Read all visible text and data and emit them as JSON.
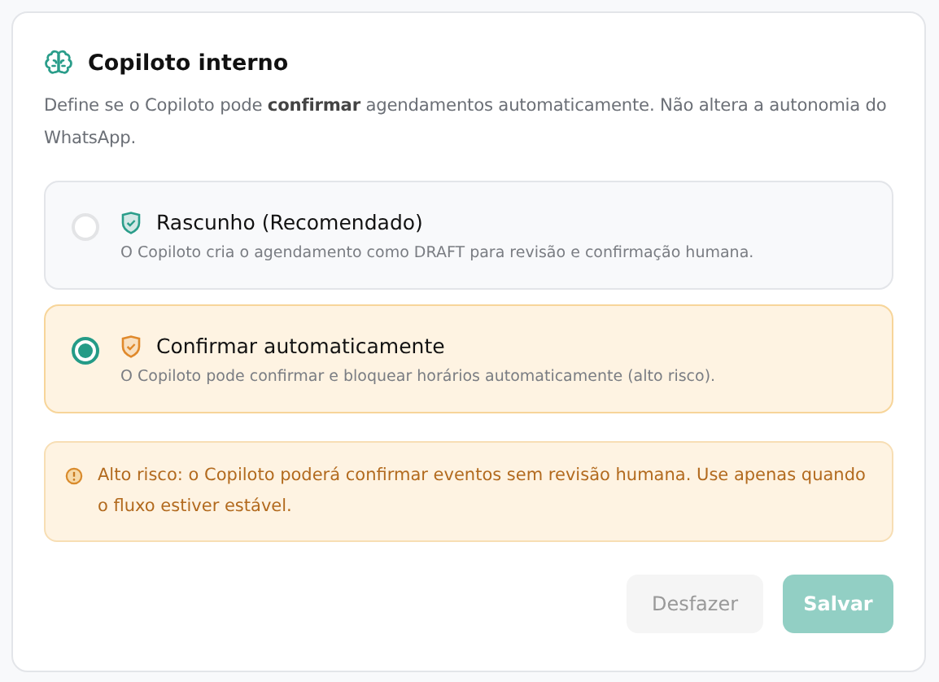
{
  "section": {
    "title": "Copiloto interno",
    "description": "Define se o Copiloto pode **confirmar** agendamentos automaticamente. Não altera a autonomia do WhatsApp."
  },
  "options": [
    {
      "kind": "safe",
      "label": "Rascunho (Recomendado)",
      "description": "O Copiloto cria o agendamento como DRAFT para revisão e confirmação humana.",
      "selected": false
    },
    {
      "kind": "risky",
      "label": "Confirmar automaticamente",
      "description": "O Copiloto pode confirmar e bloquear horários automaticamente (alto risco).",
      "selected": true
    }
  ],
  "warning": {
    "text": "Alto risco: o Copiloto poderá confirmar eventos sem revisão humana. Use apenas quando o fluxo estiver estável."
  },
  "buttons": [
    {
      "kind": "secondary",
      "label": "Desfazer",
      "disabled": true
    },
    {
      "kind": "primary",
      "label": "Salvar",
      "disabled": true
    }
  ]
}
